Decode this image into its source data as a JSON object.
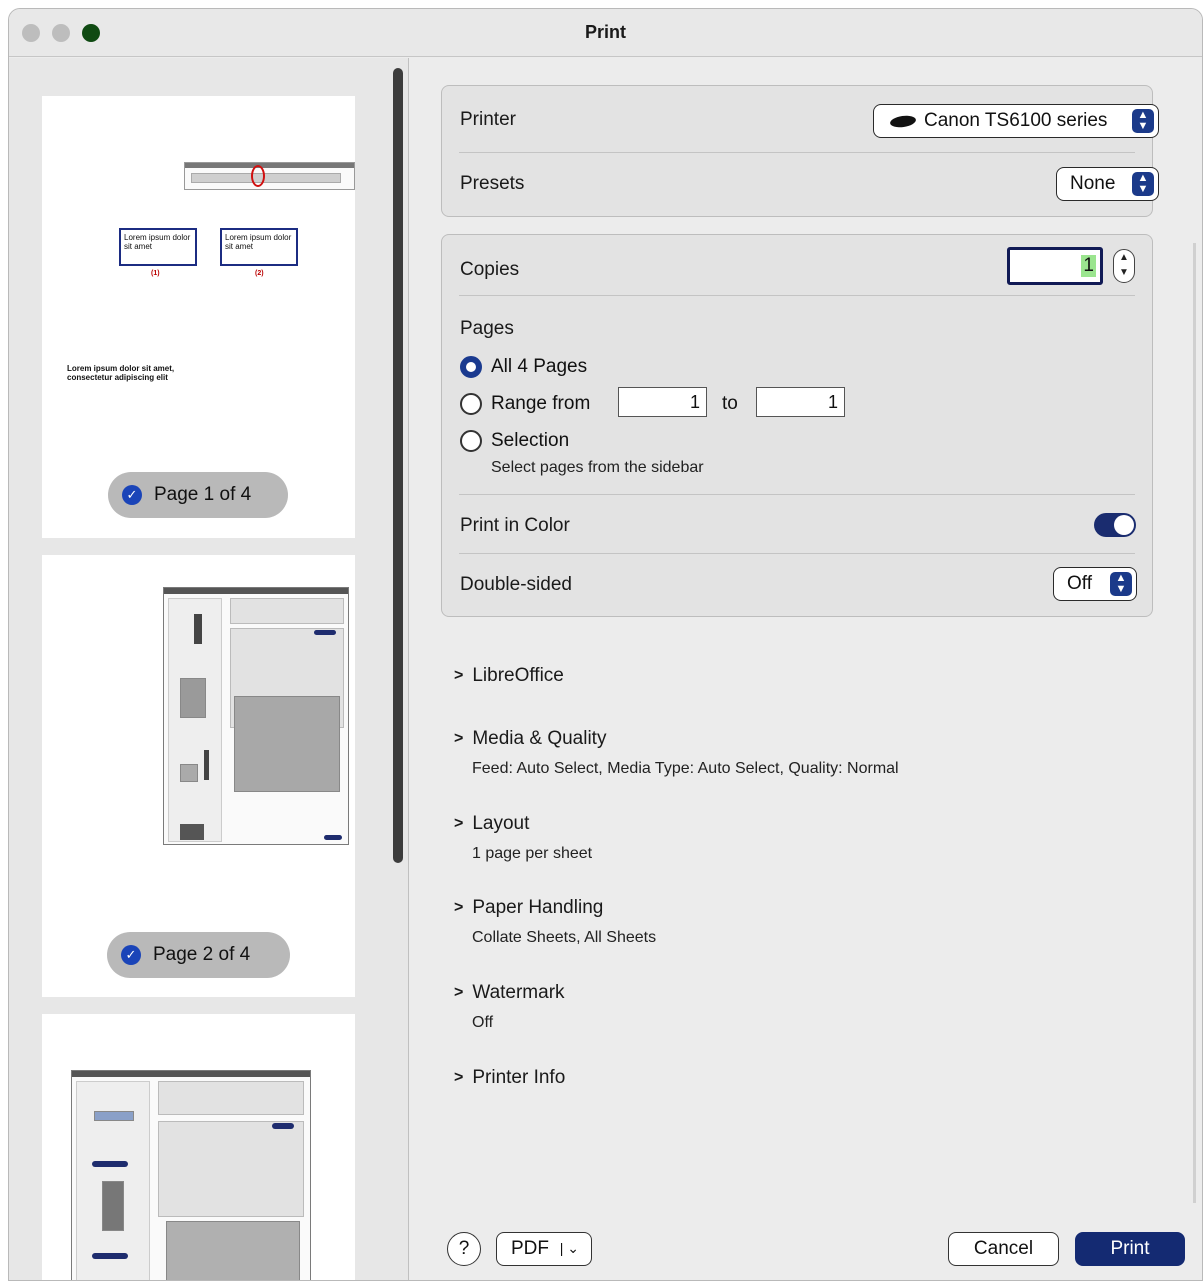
{
  "window": {
    "title": "Print"
  },
  "sidebar": {
    "pages": [
      {
        "label": "Page 1 of 4",
        "selected": true
      },
      {
        "label": "Page 2 of 4",
        "selected": true
      }
    ],
    "preview1": {
      "box1_text": "Lorem ipsum dolor sit amet",
      "box2_text": "Lorem ipsum dolor sit amet",
      "caption1": "(1)",
      "caption2": "(2)",
      "paragraph": "Lorem ipsum dolor sit amet, consectetur adipiscing elit"
    }
  },
  "printer": {
    "label": "Printer",
    "value": "Canon TS6100 series"
  },
  "presets": {
    "label": "Presets",
    "value": "None"
  },
  "copies": {
    "label": "Copies",
    "value": "1"
  },
  "pages": {
    "label": "Pages",
    "all_label": "All 4 Pages",
    "range_label": "Range from",
    "range_from": "1",
    "to_label": "to",
    "range_to": "1",
    "selection_label": "Selection",
    "selection_note": "Select pages from the sidebar",
    "selected_option": "all"
  },
  "print_in_color": {
    "label": "Print in Color",
    "on": true
  },
  "double_sided": {
    "label": "Double-sided",
    "value": "Off"
  },
  "sections": [
    {
      "title": "LibreOffice",
      "summary": ""
    },
    {
      "title": "Media & Quality",
      "summary": "Feed: Auto Select, Media Type: Auto Select, Quality: Normal"
    },
    {
      "title": "Layout",
      "summary": "1 page per sheet"
    },
    {
      "title": "Paper Handling",
      "summary": "Collate Sheets, All Sheets"
    },
    {
      "title": "Watermark",
      "summary": "Off"
    },
    {
      "title": "Printer Info",
      "summary": ""
    }
  ],
  "footer": {
    "help": "?",
    "pdf": "PDF",
    "cancel": "Cancel",
    "print": "Print"
  },
  "colors": {
    "accent": "#142a72",
    "toggle_on": "#1a2c6f",
    "check": "#1a44b8"
  }
}
